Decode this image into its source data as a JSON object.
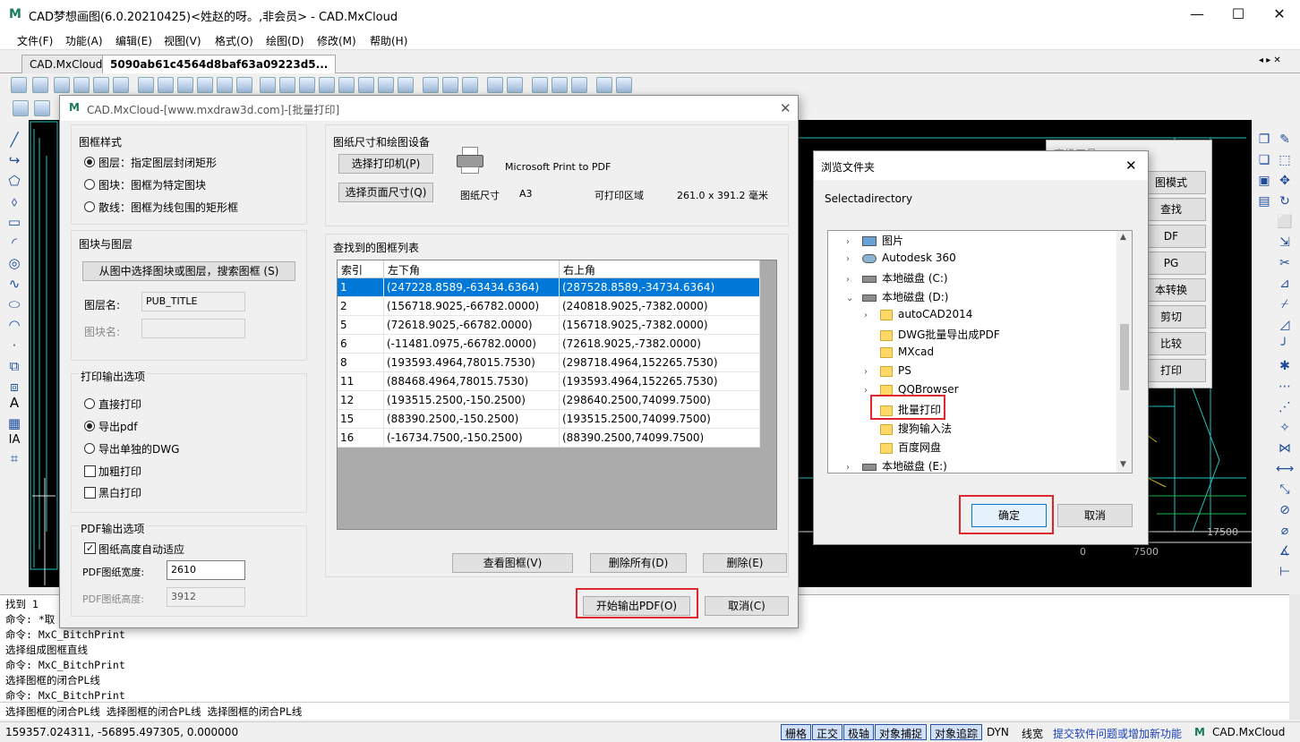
{
  "window": {
    "title": "CAD梦想画图(6.0.20210425)<姓赵的呀。,非会员> - CAD.MxCloud",
    "minimize": "—",
    "maximize": "☐",
    "close": "✕"
  },
  "menu": [
    "文件(F)",
    "功能(A)",
    "编辑(E)",
    "视图(V)",
    "格式(O)",
    "绘图(D)",
    "修改(M)",
    "帮助(H)"
  ],
  "tabs": [
    "CAD.MxCloud",
    "5090ab61c4564d8baf63a09223d5..."
  ],
  "tab_nav": "◂ ▸ ✕",
  "print_dialog": {
    "title": "CAD.MxCloud-[www.mxdraw3d.com]-[批量打印]",
    "frame_style": {
      "label": "图框样式",
      "options": [
        "图层：指定图层封闭矩形",
        "图块：图框为特定图块",
        "散线：图框为线包围的矩形框"
      ],
      "selected": 0
    },
    "block_layer": {
      "label": "图块与图层",
      "pick_button": "从图中选择图块或图层，搜索图框 (S)",
      "layer_label": "图层名:",
      "layer_value": "PUB_TITLE",
      "block_label": "图块名:",
      "block_value": ""
    },
    "print_output": {
      "label": "打印输出选项",
      "options": [
        "直接打印",
        "导出pdf",
        "导出单独的DWG"
      ],
      "selected": 1,
      "checks": [
        {
          "label": "加粗打印",
          "checked": false
        },
        {
          "label": "黑白打印",
          "checked": false
        }
      ]
    },
    "pdf_output": {
      "label": "PDF输出选项",
      "auto_label": "图纸高度自动适应",
      "auto_checked": true,
      "width_label": "PDF图纸宽度:",
      "width_value": "2610",
      "height_label": "PDF图纸高度:",
      "height_value": "3912"
    },
    "paper": {
      "label": "图纸尺寸和绘图设备",
      "printer_button": "选择打印机(P)",
      "size_button": "选择页面尺寸(Q)",
      "printer_name": "Microsoft Print to PDF",
      "size_label": "图纸尺寸",
      "size_value": "A3",
      "area_label": "可打印区域",
      "area_value": "261.0 x 391.2 毫米"
    },
    "list": {
      "label": "查找到的图框列表",
      "columns": [
        "索引",
        "左下角",
        "右上角"
      ],
      "rows": [
        [
          "1",
          "(247228.8589,-63434.6364)",
          "(287528.8589,-34734.6364)"
        ],
        [
          "2",
          "(156718.9025,-66782.0000)",
          "(240818.9025,-7382.0000)"
        ],
        [
          "5",
          "(72618.9025,-66782.0000)",
          "(156718.9025,-7382.0000)"
        ],
        [
          "6",
          "(-11481.0975,-66782.0000)",
          "(72618.9025,-7382.0000)"
        ],
        [
          "8",
          "(193593.4964,78015.7530)",
          "(298718.4964,152265.7530)"
        ],
        [
          "11",
          "(88468.4964,78015.7530)",
          "(193593.4964,152265.7530)"
        ],
        [
          "12",
          "(193515.2500,-150.2500)",
          "(298640.2500,74099.7500)"
        ],
        [
          "15",
          "(88390.2500,-150.2500)",
          "(193515.2500,74099.7500)"
        ],
        [
          "16",
          "(-16734.7500,-150.2500)",
          "(88390.2500,74099.7500)"
        ]
      ],
      "selected_row": 0
    },
    "buttons": {
      "view": "查看图框(V)",
      "delete_all": "删除所有(D)",
      "delete": "删除(E)",
      "start": "开始输出PDF(O)",
      "cancel": "取消(C)"
    }
  },
  "folder_dialog": {
    "title": "浏览文件夹",
    "prompt": "Selectadirectory",
    "tree": [
      {
        "label": "图片",
        "type": "pictures",
        "expand": "›"
      },
      {
        "label": "Autodesk 360",
        "type": "cloud",
        "expand": "›"
      },
      {
        "label": "本地磁盘 (C:)",
        "type": "drive",
        "expand": "›"
      },
      {
        "label": "本地磁盘 (D:)",
        "type": "drive",
        "expand": "⌄"
      },
      {
        "label": "autoCAD2014",
        "type": "folder",
        "expand": "›"
      },
      {
        "label": "DWG批量导出成PDF",
        "type": "folder",
        "expand": ""
      },
      {
        "label": "MXcad",
        "type": "folder",
        "expand": ""
      },
      {
        "label": "PS",
        "type": "folder",
        "expand": "›"
      },
      {
        "label": "QQBrowser",
        "type": "folder",
        "expand": "›"
      },
      {
        "label": "批量打印",
        "type": "folder",
        "expand": ""
      },
      {
        "label": "搜狗输入法",
        "type": "folder",
        "expand": ""
      },
      {
        "label": "百度网盘",
        "type": "folder",
        "expand": ""
      },
      {
        "label": "本地磁盘 (E:)",
        "type": "drive",
        "expand": "›"
      }
    ],
    "ok": "确定",
    "cancel": "取消"
  },
  "background_panel": [
    "图模式",
    "查找",
    "DF",
    "PG",
    "本转换",
    "剪切",
    "比较",
    "打印"
  ],
  "background_panel_title": "高级工具",
  "cad_numbers": [
    "17500",
    "0",
    "7500"
  ],
  "command": {
    "lines": [
      "找到 1",
      "命令:  *取",
      "命令: MxC_BitchPrint",
      " 选择组成图框直线",
      "命令: MxC_BitchPrint",
      " 选择图框的闭合PL线",
      "命令: MxC_BitchPrint"
    ],
    "input": " 选择图框的闭合PL线 选择图框的闭合PL线 选择图框的闭合PL线"
  },
  "status": {
    "coords": "159357.024311,  -56895.497305,  0.000000",
    "toggles": [
      "栅格",
      "正交",
      "极轴",
      "对象捕捉",
      "对象追踪"
    ],
    "dyn": "DYN",
    "linewidth": "线宽",
    "feedback": "提交软件问题或增加新功能",
    "brand": "CAD.MxCloud"
  },
  "colors": {
    "selection": "#0078d7",
    "highlight": "#e0262d",
    "canvas": "#000000",
    "link": "#1a3fb8"
  }
}
